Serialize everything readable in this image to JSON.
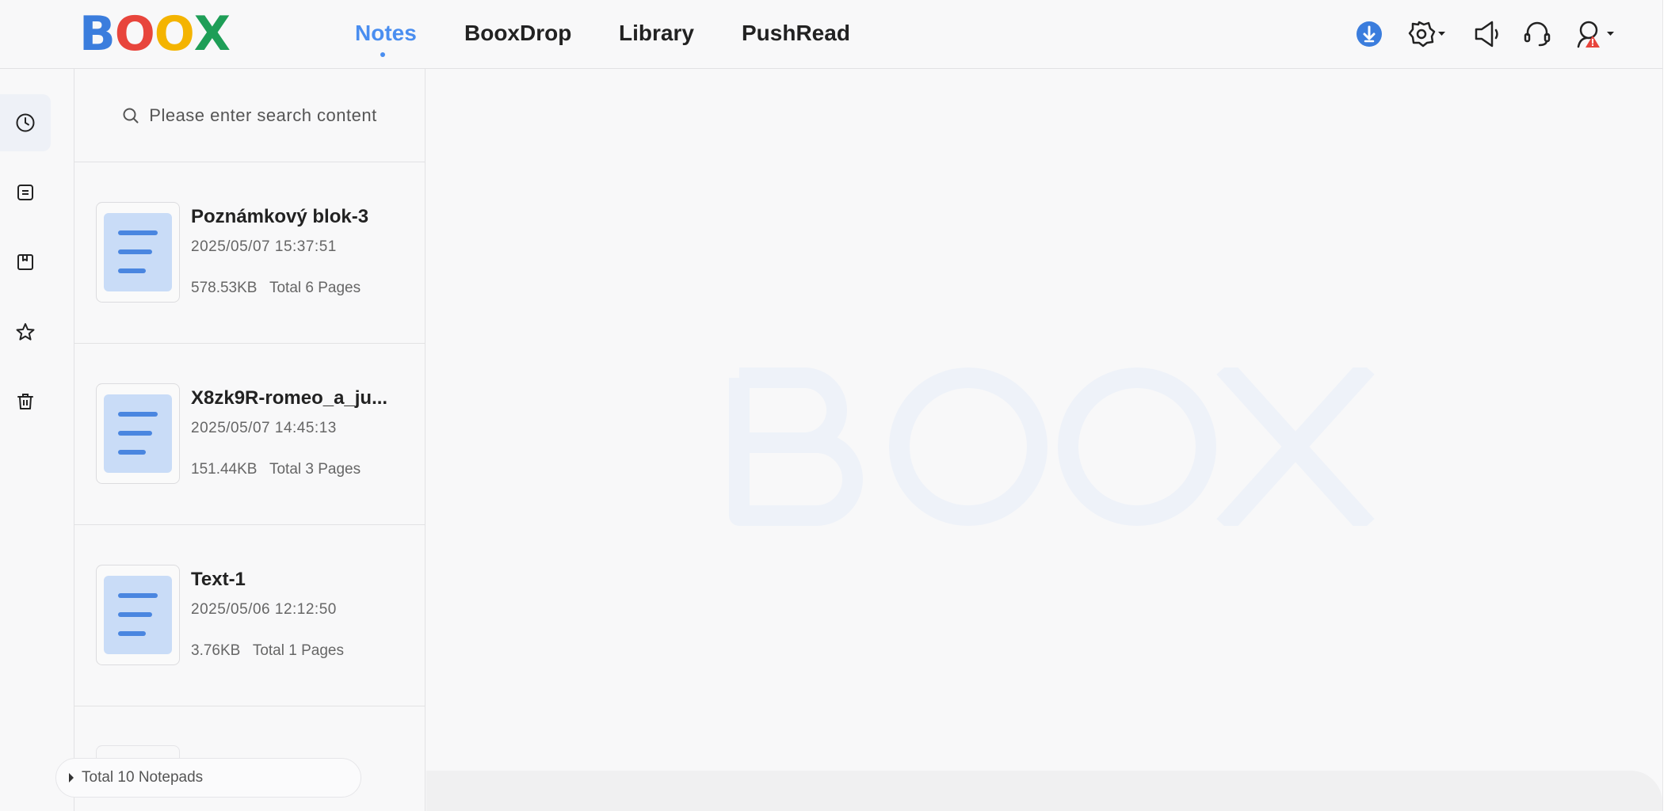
{
  "app": {
    "logo": "BOOX",
    "logo_colors": [
      "#3b7ddd",
      "#e8453c",
      "#f4b400",
      "#1e9e57"
    ]
  },
  "nav": {
    "tabs": [
      {
        "label": "Notes",
        "active": true
      },
      {
        "label": "BooxDrop",
        "active": false
      },
      {
        "label": "Library",
        "active": false
      },
      {
        "label": "PushRead",
        "active": false
      }
    ],
    "accent": "#4a8ef0"
  },
  "toolbar": {
    "icons": [
      "download-icon",
      "settings-icon",
      "announcement-icon",
      "support-icon",
      "account-icon"
    ],
    "download_color": "#3b7ddd",
    "alert_color": "#e8453c"
  },
  "rail": {
    "items": [
      {
        "icon": "clock-icon",
        "name": "recent",
        "active": true
      },
      {
        "icon": "note-icon",
        "name": "notes",
        "active": false
      },
      {
        "icon": "notebook-icon",
        "name": "notebooks",
        "active": false
      },
      {
        "icon": "star-icon",
        "name": "favorites",
        "active": false
      },
      {
        "icon": "trash-icon",
        "name": "trash",
        "active": false
      }
    ]
  },
  "search": {
    "placeholder": "Please enter search content"
  },
  "notes": [
    {
      "title": "Poznámkový blok-3",
      "date": "2025/05/07 15:37:51",
      "size": "578.53KB",
      "pages": "Total 6 Pages"
    },
    {
      "title": "X8zk9R-romeo_a_ju...",
      "date": "2025/05/07 14:45:13",
      "size": "151.44KB",
      "pages": "Total 3 Pages"
    },
    {
      "title": "Text-1",
      "date": "2025/05/06 12:12:50",
      "size": "3.76KB",
      "pages": "Total 1 Pages"
    }
  ],
  "footer": {
    "count_label": "Total 10 Notepads"
  },
  "watermark": {
    "text": "BOOX",
    "color": "#eef2f9"
  }
}
